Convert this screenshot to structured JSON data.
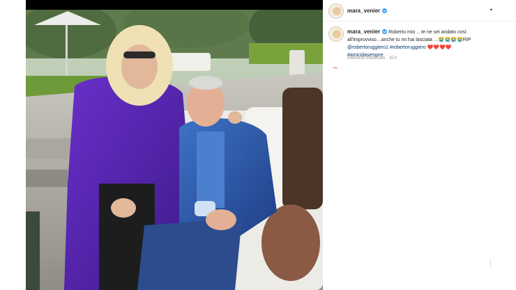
{
  "post": {
    "username": "mara_venier",
    "more_icon": "more-horizontal-icon"
  },
  "caption": {
    "username": "mara_venier",
    "text_line1": "Roberto mio …te ne sei andato così",
    "text_line2": "all'improvviso…anche tu mi hai lasciata …",
    "emojis": "😭😭😭😭",
    "rip": "RIP",
    "mention1": "@robertoruggiero1",
    "hashtag1": "#robertoruggiero",
    "hearts": "❤️❤️❤️❤️",
    "hashtag2": "#amicidasempre",
    "meta": "Elemento modificato · 15 h"
  },
  "colors": {
    "verified": "#3897f0",
    "hashtag": "#00376b",
    "meta": "#8e8e8e"
  }
}
